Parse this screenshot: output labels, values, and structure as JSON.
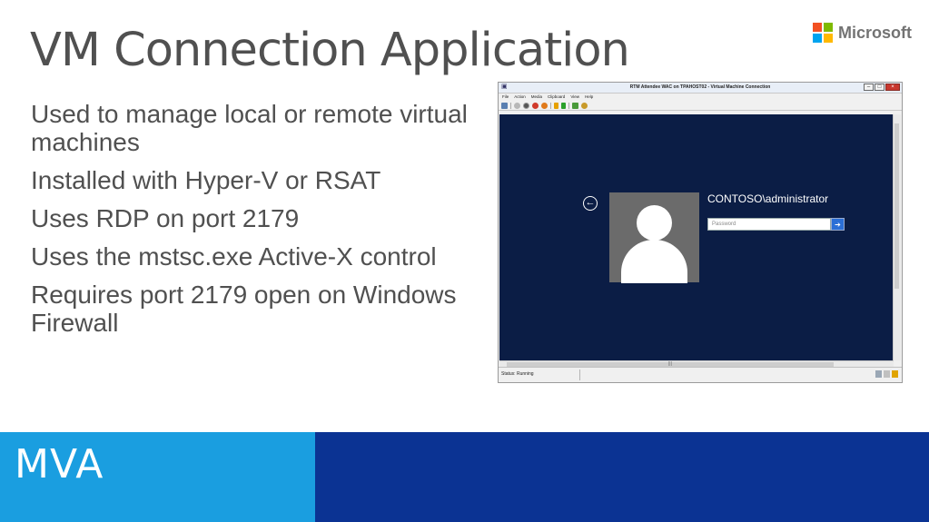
{
  "slide": {
    "title": "VM Connection Application",
    "bullets": [
      "Used to manage local or remote virtual machines",
      "Installed with Hyper-V or RSAT",
      "Uses RDP on port 2179",
      "Uses the mstsc.exe Active-X control",
      "Requires port 2179 open on Windows Firewall"
    ],
    "footer_text": "MVA",
    "footer_colors": {
      "left": "#1a9ee0",
      "right": "#0b3393"
    }
  },
  "logo": {
    "text": "Microsoft",
    "colors": [
      "#f25022",
      "#7fba00",
      "#00a4ef",
      "#ffb900"
    ]
  },
  "vm_window": {
    "title": "RTM Attendee WAC on TPAHOST02 - Virtual Machine Connection",
    "menu": [
      "File",
      "Action",
      "Media",
      "Clipboard",
      "View",
      "Help"
    ],
    "toolbar_icons": [
      "ctrl-alt-del-icon",
      "start-icon",
      "turn-off-icon",
      "shutdown-icon",
      "save-icon",
      "pause-icon",
      "resume-icon",
      "checkpoint-icon",
      "revert-icon"
    ],
    "login": {
      "username": "CONTOSO\\administrator",
      "password_placeholder": "Password",
      "submit_glyph": "➔",
      "back_glyph": "←"
    },
    "status": "Status: Running",
    "screen_color": "#0b1d45"
  }
}
